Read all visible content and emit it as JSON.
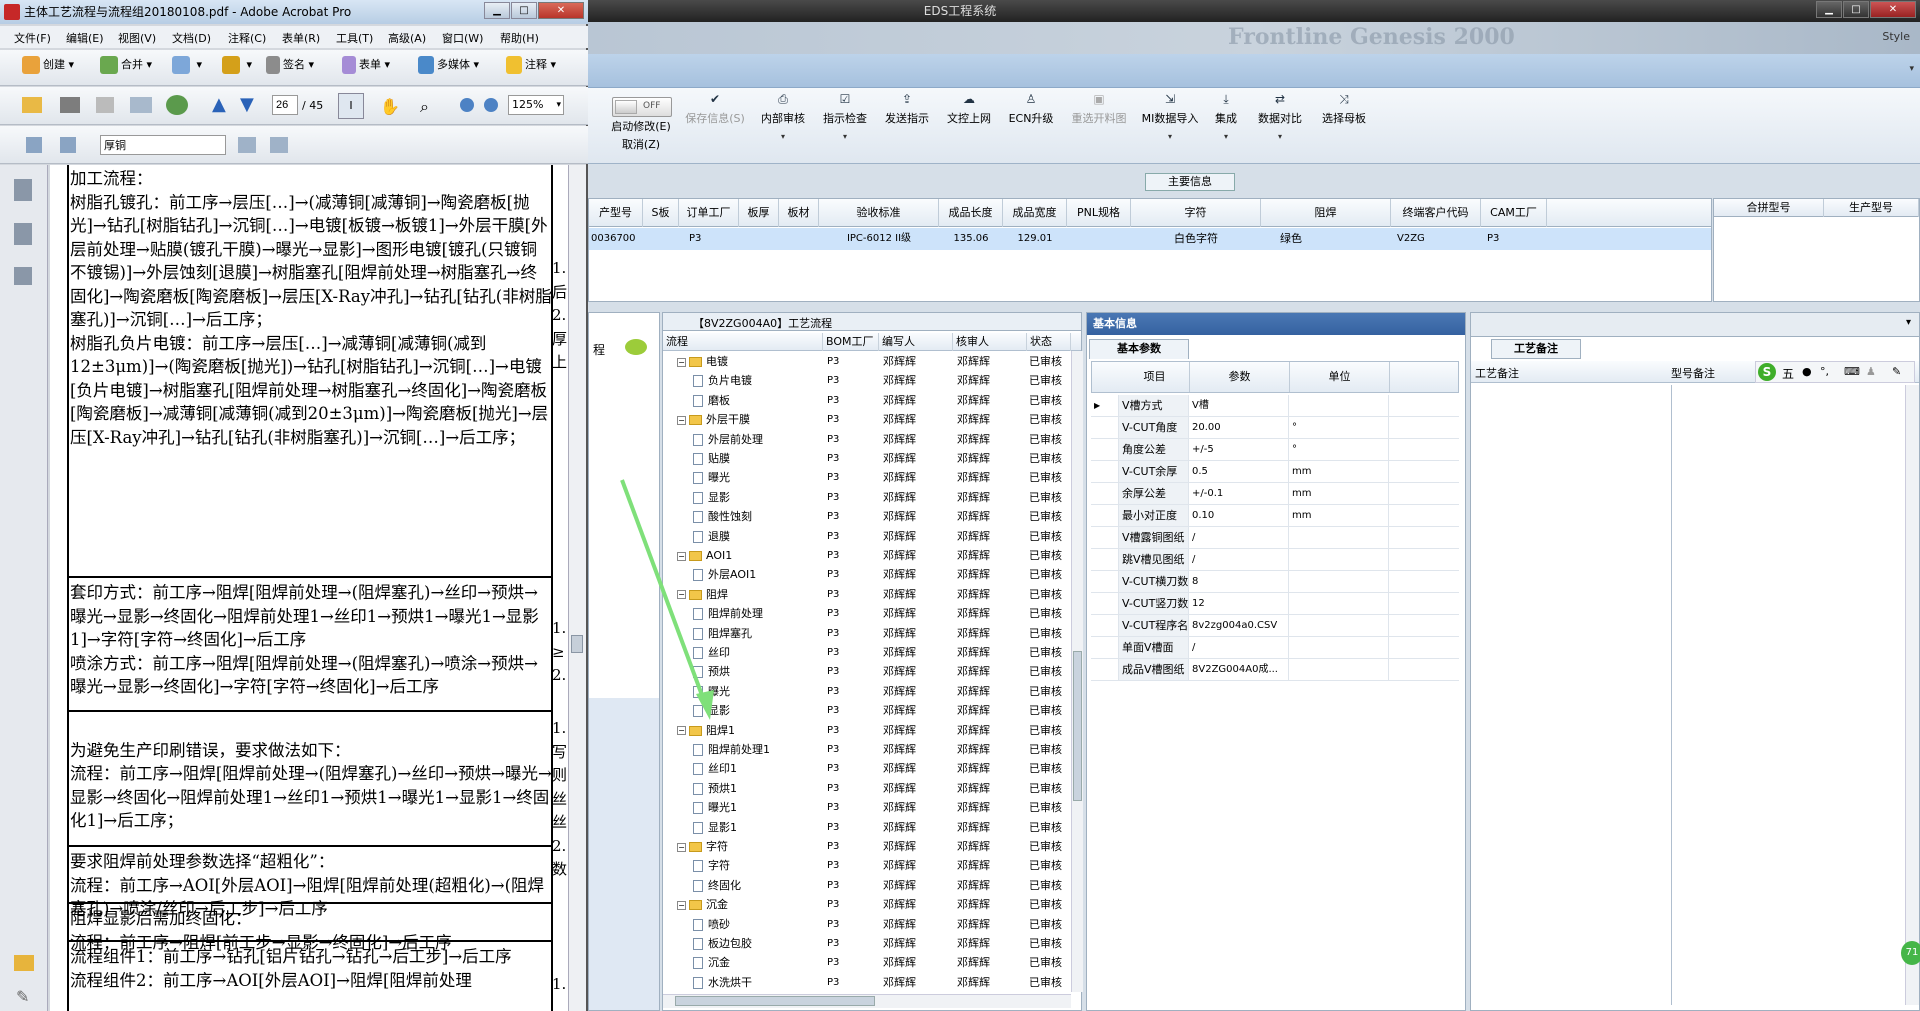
{
  "eds": {
    "title": "EDS工程系统",
    "style_label": "Style",
    "banner_text": "Frontline  Genesis 2000",
    "ribbon": {
      "toggle_label": "OFF",
      "buttons": [
        {
          "label": "启动修改(E)",
          "sub": "取消(Z)",
          "disabled": false
        },
        {
          "label": "保存信息(S)",
          "disabled": true
        },
        {
          "label": "内部审核",
          "disabled": false
        },
        {
          "label": "指示检查",
          "disabled": false
        },
        {
          "label": "发送指示",
          "disabled": false
        },
        {
          "label": "文控上网",
          "disabled": false
        },
        {
          "label": "ECN升级",
          "disabled": false
        },
        {
          "label": "重选开料图",
          "disabled": true
        },
        {
          "label": "MI数据导入",
          "disabled": false
        },
        {
          "label": "集成",
          "disabled": false
        },
        {
          "label": "数据对比",
          "disabled": false
        },
        {
          "label": "选择母板",
          "disabled": false
        }
      ]
    },
    "main_info_label": "主要信息",
    "main_grid": {
      "headers": [
        "产型号",
        "S板",
        "订单工厂",
        "板厚",
        "板材",
        "验收标准",
        "成品长度",
        "成品宽度",
        "PNL规格",
        "字符",
        "阻焊",
        "终端客户代码",
        "CAM工厂"
      ],
      "row": [
        "0036700",
        "",
        "P3",
        "",
        "",
        "IPC-6012 II级",
        "135.06",
        "129.01",
        "",
        "白色字符",
        "绿色",
        "V2ZG",
        "P3"
      ]
    },
    "side_grid_headers": [
      "合拼型号",
      "生产型号"
    ],
    "left_panel_label": "程",
    "flow": {
      "title": "【8V2ZG004A0】工艺流程",
      "headers": [
        "流程",
        "BOM工厂",
        "编写人",
        "核审人",
        "状态"
      ],
      "rows": [
        {
          "level": 0,
          "name": "电镀",
          "folder": true,
          "bom": "P3",
          "writer": "邓辉辉",
          "reviewer": "邓辉辉",
          "status": "已审核"
        },
        {
          "level": 1,
          "name": "负片电镀",
          "folder": false,
          "bom": "P3",
          "writer": "邓辉辉",
          "reviewer": "邓辉辉",
          "status": "已审核"
        },
        {
          "level": 1,
          "name": "磨板",
          "folder": false,
          "bom": "P3",
          "writer": "邓辉辉",
          "reviewer": "邓辉辉",
          "status": "已审核"
        },
        {
          "level": 0,
          "name": "外层干膜",
          "folder": true,
          "bom": "P3",
          "writer": "邓辉辉",
          "reviewer": "邓辉辉",
          "status": "已审核"
        },
        {
          "level": 1,
          "name": "外层前处理",
          "folder": false,
          "bom": "P3",
          "writer": "邓辉辉",
          "reviewer": "邓辉辉",
          "status": "已审核"
        },
        {
          "level": 1,
          "name": "贴膜",
          "folder": false,
          "bom": "P3",
          "writer": "邓辉辉",
          "reviewer": "邓辉辉",
          "status": "已审核"
        },
        {
          "level": 1,
          "name": "曝光",
          "folder": false,
          "bom": "P3",
          "writer": "邓辉辉",
          "reviewer": "邓辉辉",
          "status": "已审核"
        },
        {
          "level": 1,
          "name": "显影",
          "folder": false,
          "bom": "P3",
          "writer": "邓辉辉",
          "reviewer": "邓辉辉",
          "status": "已审核"
        },
        {
          "level": 1,
          "name": "酸性蚀刻",
          "folder": false,
          "bom": "P3",
          "writer": "邓辉辉",
          "reviewer": "邓辉辉",
          "status": "已审核"
        },
        {
          "level": 1,
          "name": "退膜",
          "folder": false,
          "bom": "P3",
          "writer": "邓辉辉",
          "reviewer": "邓辉辉",
          "status": "已审核"
        },
        {
          "level": 0,
          "name": "AOI1",
          "folder": true,
          "bom": "P3",
          "writer": "邓辉辉",
          "reviewer": "邓辉辉",
          "status": "已审核"
        },
        {
          "level": 1,
          "name": "外层AOI1",
          "folder": false,
          "bom": "P3",
          "writer": "邓辉辉",
          "reviewer": "邓辉辉",
          "status": "已审核"
        },
        {
          "level": 0,
          "name": "阻焊",
          "folder": true,
          "bom": "P3",
          "writer": "邓辉辉",
          "reviewer": "邓辉辉",
          "status": "已审核"
        },
        {
          "level": 1,
          "name": "阻焊前处理",
          "folder": false,
          "bom": "P3",
          "writer": "邓辉辉",
          "reviewer": "邓辉辉",
          "status": "已审核"
        },
        {
          "level": 1,
          "name": "阻焊塞孔",
          "folder": false,
          "bom": "P3",
          "writer": "邓辉辉",
          "reviewer": "邓辉辉",
          "status": "已审核"
        },
        {
          "level": 1,
          "name": "丝印",
          "folder": false,
          "bom": "P3",
          "writer": "邓辉辉",
          "reviewer": "邓辉辉",
          "status": "已审核"
        },
        {
          "level": 1,
          "name": "预烘",
          "folder": false,
          "bom": "P3",
          "writer": "邓辉辉",
          "reviewer": "邓辉辉",
          "status": "已审核"
        },
        {
          "level": 1,
          "name": "曝光",
          "folder": false,
          "bom": "P3",
          "writer": "邓辉辉",
          "reviewer": "邓辉辉",
          "status": "已审核"
        },
        {
          "level": 1,
          "name": "显影",
          "folder": false,
          "bom": "P3",
          "writer": "邓辉辉",
          "reviewer": "邓辉辉",
          "status": "已审核"
        },
        {
          "level": 0,
          "name": "阻焊1",
          "folder": true,
          "bom": "P3",
          "writer": "邓辉辉",
          "reviewer": "邓辉辉",
          "status": "已审核"
        },
        {
          "level": 1,
          "name": "阻焊前处理1",
          "folder": false,
          "bom": "P3",
          "writer": "邓辉辉",
          "reviewer": "邓辉辉",
          "status": "已审核"
        },
        {
          "level": 1,
          "name": "丝印1",
          "folder": false,
          "bom": "P3",
          "writer": "邓辉辉",
          "reviewer": "邓辉辉",
          "status": "已审核"
        },
        {
          "level": 1,
          "name": "预烘1",
          "folder": false,
          "bom": "P3",
          "writer": "邓辉辉",
          "reviewer": "邓辉辉",
          "status": "已审核"
        },
        {
          "level": 1,
          "name": "曝光1",
          "folder": false,
          "bom": "P3",
          "writer": "邓辉辉",
          "reviewer": "邓辉辉",
          "status": "已审核"
        },
        {
          "level": 1,
          "name": "显影1",
          "folder": false,
          "bom": "P3",
          "writer": "邓辉辉",
          "reviewer": "邓辉辉",
          "status": "已审核"
        },
        {
          "level": 0,
          "name": "字符",
          "folder": true,
          "bom": "P3",
          "writer": "邓辉辉",
          "reviewer": "邓辉辉",
          "status": "已审核"
        },
        {
          "level": 1,
          "name": "字符",
          "folder": false,
          "bom": "P3",
          "writer": "邓辉辉",
          "reviewer": "邓辉辉",
          "status": "已审核"
        },
        {
          "level": 1,
          "name": "终固化",
          "folder": false,
          "bom": "P3",
          "writer": "邓辉辉",
          "reviewer": "邓辉辉",
          "status": "已审核"
        },
        {
          "level": 0,
          "name": "沉金",
          "folder": true,
          "bom": "P3",
          "writer": "邓辉辉",
          "reviewer": "邓辉辉",
          "status": "已审核"
        },
        {
          "level": 1,
          "name": "喷砂",
          "folder": false,
          "bom": "P3",
          "writer": "邓辉辉",
          "reviewer": "邓辉辉",
          "status": "已审核"
        },
        {
          "level": 1,
          "name": "板边包胶",
          "folder": false,
          "bom": "P3",
          "writer": "邓辉辉",
          "reviewer": "邓辉辉",
          "status": "已审核"
        },
        {
          "level": 1,
          "name": "沉金",
          "folder": false,
          "bom": "P3",
          "writer": "邓辉辉",
          "reviewer": "邓辉辉",
          "status": "已审核"
        },
        {
          "level": 1,
          "name": "水洗烘干",
          "folder": false,
          "bom": "P3",
          "writer": "邓辉辉",
          "reviewer": "邓辉辉",
          "status": "已审核"
        }
      ]
    },
    "basic": {
      "title": "基本信息",
      "tab": "基本参数",
      "headers": [
        "项目",
        "参数",
        "单位"
      ],
      "rows": [
        {
          "item": "V槽方式",
          "value": "V槽",
          "unit": ""
        },
        {
          "item": "V-CUT角度",
          "value": "20.00",
          "unit": "°"
        },
        {
          "item": "角度公差",
          "value": "+/-5",
          "unit": "°"
        },
        {
          "item": "V-CUT余厚",
          "value": "0.5",
          "unit": "mm"
        },
        {
          "item": "余厚公差",
          "value": "+/-0.1",
          "unit": "mm"
        },
        {
          "item": "最小对正度",
          "value": "0.10",
          "unit": "mm"
        },
        {
          "item": "V槽露铜图纸",
          "value": "/",
          "unit": ""
        },
        {
          "item": "跳V槽见图纸",
          "value": "/",
          "unit": ""
        },
        {
          "item": "V-CUT横刀数",
          "value": "8",
          "unit": ""
        },
        {
          "item": "V-CUT竖刀数",
          "value": "12",
          "unit": ""
        },
        {
          "item": "V-CUT程序名",
          "value": "8v2zg004a0.CSV",
          "unit": ""
        },
        {
          "item": "单面V槽面",
          "value": "/",
          "unit": ""
        },
        {
          "item": "成品V槽图纸",
          "value": "8V2ZG004A0成...",
          "unit": ""
        }
      ]
    },
    "notes": {
      "tab": "工艺备注",
      "col1": "工艺备注",
      "col2": "型号备注",
      "ime_label": "五",
      "badge": "71"
    }
  },
  "acrobat": {
    "title": "主体工艺流程与流程组20180108.pdf - Adobe Acrobat Pro",
    "menu": [
      "文件(F)",
      "编辑(E)",
      "视图(V)",
      "文档(D)",
      "注释(C)",
      "表单(R)",
      "工具(T)",
      "高级(A)",
      "窗口(W)",
      "帮助(H)"
    ],
    "toolbar1": [
      "创建",
      "合并",
      "",
      "",
      "签名",
      "表单",
      "多媒体",
      "注释"
    ],
    "page_current": "26",
    "page_total": "/ 45",
    "zoom": "125%",
    "search_value": "厚铜",
    "pdf_blocks": [
      "加工流程：\n树脂孔镀孔：前工序→层压[…]→(减薄铜[减薄铜]→陶瓷磨板[抛光]→钻孔[树脂钻孔]→沉铜[…]→电镀[板镀→板镀1]→外层干膜[外层前处理→贴膜(镀孔干膜)→曝光→显影]→图形电镀[镀孔(只镀铜不镀锡)]→外层蚀刻[退膜]→树脂塞孔[阻焊前处理→树脂塞孔→终固化]→陶瓷磨板[陶瓷磨板]→层压[X-Ray冲孔]→钻孔[钻孔(非树脂塞孔)]→沉铜[…]→后工序；\n树脂孔负片电镀：前工序→层压[…]→减薄铜[减薄铜(减到12±3μm)]→(陶瓷磨板[抛光])→钻孔[树脂钻孔]→沉铜[…]→电镀[负片电镀]→树脂塞孔[阻焊前处理→树脂塞孔→终固化]→陶瓷磨板[陶瓷磨板]→减薄铜[减薄铜(减到20±3μm)]→陶瓷磨板[抛光]→层压[X-Ray冲孔]→钻孔[钻孔(非树脂塞孔)]→沉铜[…]→后工序；",
      "套印方式：前工序→阻焊[阻焊前处理→(阻焊塞孔)→丝印→预烘→曝光→显影→终固化→阻焊前处理1→丝印1→预烘1→曝光1→显影1]→字符[字符→终固化]→后工序\n喷涂方式：前工序→阻焊[阻焊前处理→(阻焊塞孔)→喷涂→预烘→曝光→显影→终固化]→字符[字符→终固化]→后工序",
      "\n为避免生产印刷错误，要求做法如下：\n流程：前工序→阻焊[阻焊前处理→(阻焊塞孔)→丝印→预烘→曝光→显影→终固化→阻焊前处理1→丝印1→预烘1→曝光1→显影1→终固化1]→后工序；",
      "要求阻焊前处理参数选择“超粗化”：\n流程：前工序→AOI[外层AOI]→阻焊[阻焊前处理(超粗化)→(阻焊塞孔)→喷涂/丝印→后工步]→后工序",
      "阻焊显影后需加终固化：\n流程：前工序→阻焊[前工步→显影→终固化]→后工序",
      "流程组件1：前工序→钻孔[铝片钻孔→钻孔→后工步]→后工序\n流程组件2：前工序→AOI[外层AOI]→阻焊[阻焊前处理"
    ],
    "pdf_right_fragments": [
      "1.\n后\n2.\n厚\n上",
      "1.\n≥\n2.",
      "1.\n写\n则\n丝\n丝\n2.\n数",
      "",
      "",
      "1."
    ]
  }
}
